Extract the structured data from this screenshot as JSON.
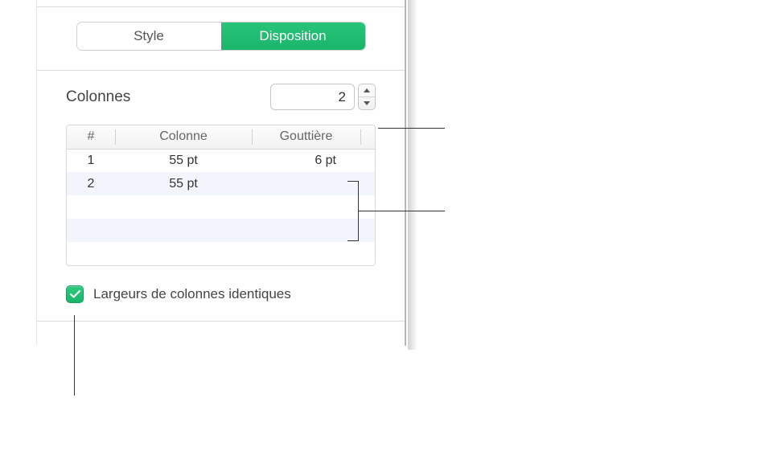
{
  "tabs": {
    "style": "Style",
    "disposition": "Disposition"
  },
  "columns": {
    "label": "Colonnes",
    "count": "2"
  },
  "table": {
    "headers": {
      "hash": "#",
      "column": "Colonne",
      "gutter": "Gouttière"
    },
    "rows": [
      {
        "n": "1",
        "col": "55 pt",
        "gutter": "6 pt"
      },
      {
        "n": "2",
        "col": "55 pt",
        "gutter": ""
      }
    ]
  },
  "equalWidths": {
    "label": "Largeurs de colonnes identiques",
    "checked": true
  }
}
